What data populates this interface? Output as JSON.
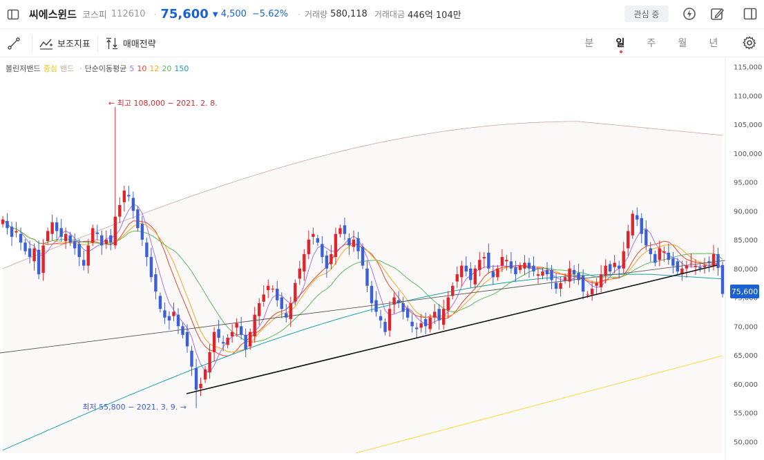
{
  "header": {
    "stock_name": "씨에스윈드",
    "market": "코스피",
    "code": "112610",
    "price": "75,600",
    "change_arrow": "▼",
    "change": "4,500",
    "change_pct": "−5.62%",
    "volume_label": "거래량",
    "volume": "580,118",
    "amount_label": "거래대금",
    "amount": "446억 104만",
    "watch_label": "관심 중"
  },
  "toolbar": {
    "indicator_label": "보조지표",
    "strategy_label": "매매전략",
    "periods": [
      "분",
      "일",
      "주",
      "월",
      "년"
    ],
    "active_period": "일"
  },
  "legend": {
    "bollinger_label": "볼린저밴드",
    "bollinger_mid": "중심",
    "bollinger_band": "밴드",
    "sma_label": "단순이동평균",
    "sma": [
      {
        "name": "5",
        "color": "#a371f7"
      },
      {
        "name": "10",
        "color": "#e8452c"
      },
      {
        "name": "12",
        "color": "#f5a623"
      },
      {
        "name": "20",
        "color": "#5cb85c"
      },
      {
        "name": "150",
        "color": "#17a2a2"
      }
    ],
    "mid_color": "#f5c518",
    "band_color": "#c8a89a"
  },
  "colors": {
    "up": "#e0242c",
    "down": "#3b5fd8",
    "price_accent": "#1b61d1"
  },
  "chart_data": {
    "type": "candlestick",
    "y_ticks": [
      115000,
      110000,
      105000,
      100000,
      95000,
      90000,
      85000,
      80000,
      75000,
      70000,
      65000,
      60000,
      55000,
      50000
    ],
    "y_tick_labels": [
      "115,000",
      "110,000",
      "105,000",
      "100,000",
      "95,000",
      "90,000",
      "85,000",
      "80,000",
      "75,000",
      "70,000",
      "65,000",
      "60,000",
      "55,000",
      "50,000"
    ],
    "ylim": [
      48000,
      116500
    ],
    "current_price": 75600,
    "current_price_label": "75,600",
    "high_annotation": "← 최고 108,000 − 2021. 2. 8.",
    "low_annotation": "최저 55,800 − 2021. 3. 9. →",
    "high_value": 108000,
    "low_value": 55800,
    "closes": [
      88500,
      87000,
      85500,
      86500,
      84500,
      83000,
      82000,
      83500,
      79000,
      84000,
      86500,
      88000,
      86500,
      85500,
      86000,
      84500,
      83500,
      82000,
      80500,
      84000,
      87000,
      86000,
      84000,
      85000,
      84500,
      89000,
      91000,
      93500,
      92500,
      90000,
      87000,
      85000,
      82000,
      78500,
      76000,
      73000,
      71500,
      71000,
      72500,
      70000,
      68500,
      66500,
      63000,
      59000,
      60000,
      62500,
      65500,
      69000,
      68000,
      67000,
      68000,
      69000,
      70500,
      68500,
      66000,
      69000,
      72000,
      74000,
      75500,
      77000,
      76500,
      74500,
      73000,
      71500,
      74000,
      77500,
      80000,
      82500,
      85000,
      86000,
      84500,
      82000,
      80000,
      82500,
      86000,
      87000,
      86000,
      84000,
      85000,
      83000,
      80500,
      77000,
      74000,
      72500,
      71000,
      69000,
      73000,
      75000,
      74000,
      72500,
      71500,
      70000,
      69500,
      70500,
      70000,
      71500,
      72500,
      71000,
      73000,
      75000,
      77000,
      79000,
      80500,
      79500,
      78000,
      80000,
      81500,
      82000,
      80000,
      78500,
      80000,
      82000,
      81500,
      80000,
      79000,
      80500,
      81000,
      80000,
      79500,
      79000,
      79500,
      79000,
      78000,
      76500,
      77500,
      78500,
      80000,
      79000,
      78000,
      76000,
      75500,
      76500,
      77500,
      79000,
      80500,
      79500,
      81000,
      80000,
      83000,
      86500,
      89500,
      88500,
      86000,
      84000,
      82500,
      81000,
      83500,
      83000,
      81500,
      80500,
      79500,
      80000,
      80500,
      81000,
      80500,
      80000,
      80500,
      81000,
      82500,
      80100,
      75600
    ],
    "bollinger_upper": [
      97000,
      105000,
      104000,
      103000
    ],
    "bollinger_mid": [
      47000,
      65000
    ]
  }
}
